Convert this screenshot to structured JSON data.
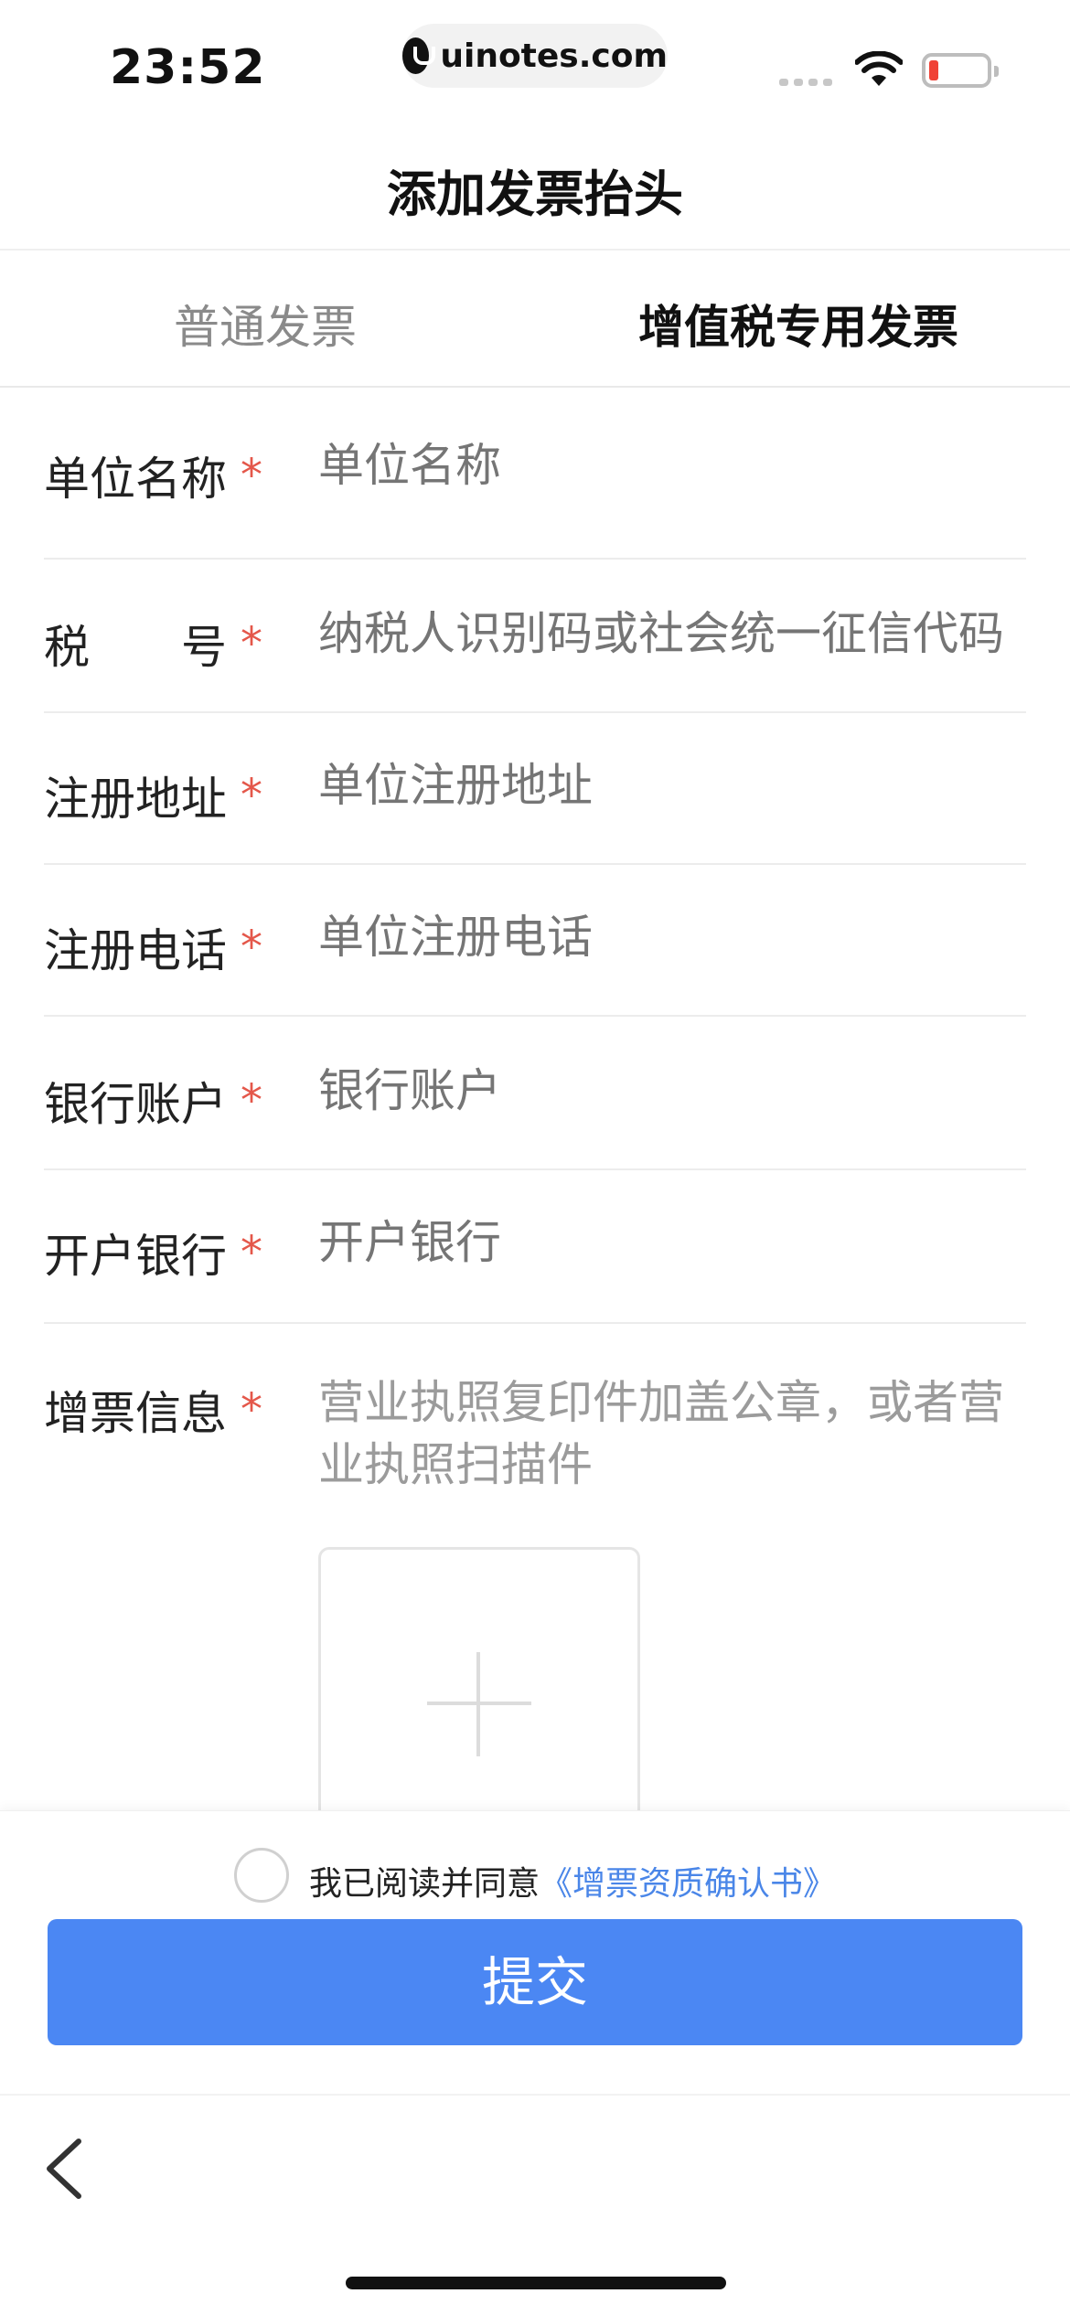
{
  "status_bar": {
    "time": "23:52",
    "url": "uinotes.com"
  },
  "header": {
    "title": "添加发票抬头"
  },
  "tabs": [
    {
      "label": "普通发票",
      "active": false
    },
    {
      "label": "增值税专用发票",
      "active": true
    }
  ],
  "form": {
    "required_mark": "*",
    "fields": [
      {
        "label": "单位名称",
        "placeholder": "单位名称"
      },
      {
        "label_first": "税",
        "label_second": "号",
        "placeholder": "纳税人识别码或社会统一征信代码"
      },
      {
        "label": "注册地址",
        "placeholder": "单位注册地址"
      },
      {
        "label": "注册电话",
        "placeholder": "单位注册电话"
      },
      {
        "label": "银行账户",
        "placeholder": "银行账户"
      },
      {
        "label": "开户银行",
        "placeholder": "开户银行"
      }
    ],
    "invoice_info": {
      "label": "增票信息",
      "description": "营业执照复印件加盖公章，或者营业执照扫描件"
    }
  },
  "agreement": {
    "text": "我已阅读并同意",
    "link": "《增票资质确认书》",
    "checked": false
  },
  "submit": {
    "label": "提交"
  },
  "colors": {
    "accent": "#4b87f3",
    "link": "#4a86e8",
    "required": "#e4574a",
    "placeholder": "#c1c1c1"
  }
}
